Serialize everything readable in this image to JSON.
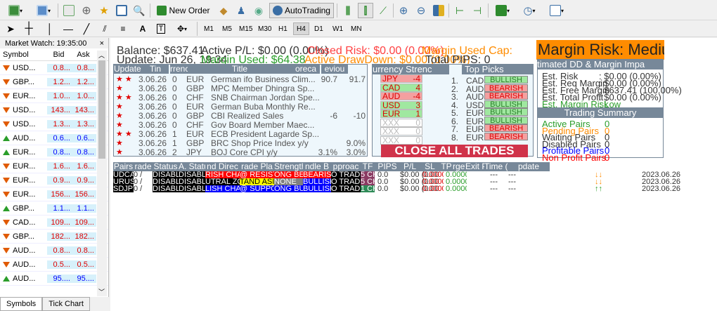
{
  "toolbar": {
    "new_order": "New Order",
    "autotrading": "AutoTrading"
  },
  "timeframes": [
    "M1",
    "M5",
    "M15",
    "M30",
    "H1",
    "H4",
    "D1",
    "W1",
    "MN"
  ],
  "active_tf": "H4",
  "market_watch": {
    "title": "Market Watch: 19:35:00",
    "cols": [
      "Symbol",
      "Bid",
      "Ask"
    ],
    "rows": [
      {
        "sym": "USD...",
        "bid": "0.8...",
        "ask": "0.8...",
        "dir": "dn"
      },
      {
        "sym": "GBP...",
        "bid": "1.2...",
        "ask": "1.2...",
        "dir": "dn"
      },
      {
        "sym": "EUR...",
        "bid": "1.0...",
        "ask": "1.0...",
        "dir": "dn"
      },
      {
        "sym": "USD...",
        "bid": "143...",
        "ask": "143...",
        "dir": "dn"
      },
      {
        "sym": "USD...",
        "bid": "1.3...",
        "ask": "1.3...",
        "dir": "dn"
      },
      {
        "sym": "AUD...",
        "bid": "0.6...",
        "ask": "0.6...",
        "dir": "up"
      },
      {
        "sym": "EUR...",
        "bid": "0.8...",
        "ask": "0.8...",
        "dir": "up"
      },
      {
        "sym": "EUR...",
        "bid": "1.6...",
        "ask": "1.6...",
        "dir": "dn"
      },
      {
        "sym": "EUR...",
        "bid": "0.9...",
        "ask": "0.9...",
        "dir": "dn"
      },
      {
        "sym": "EUR...",
        "bid": "156...",
        "ask": "156...",
        "dir": "dn"
      },
      {
        "sym": "GBP...",
        "bid": "1.1...",
        "ask": "1.1...",
        "dir": "up"
      },
      {
        "sym": "CAD...",
        "bid": "109...",
        "ask": "109...",
        "dir": "dn"
      },
      {
        "sym": "GBP...",
        "bid": "182...",
        "ask": "182...",
        "dir": "dn"
      },
      {
        "sym": "AUD...",
        "bid": "0.8...",
        "ask": "0.8...",
        "dir": "dn"
      },
      {
        "sym": "AUD...",
        "bid": "0.5...",
        "ask": "0.5...",
        "dir": "dn"
      },
      {
        "sym": "AUD...",
        "bid": "95....",
        "ask": "95....",
        "dir": "up"
      }
    ],
    "tabs": [
      "Symbols",
      "Tick Chart"
    ]
  },
  "dash": {
    "balance": "Balance:  $637.41",
    "active_pl": "Active P/L:  $0.00 (0.00%)",
    "closed_risk": "Closed Risk:  $0.00 (0.00%)",
    "margin_used_cap": "Margin Used Cap:",
    "update": "Update:  Jun  26, 19:34",
    "margin_used": "Margin Used:  $64.38",
    "active_drawdown": "Active DrawDown:  $0.00 (0.00%)",
    "total_pips": "Total PIPS: 0",
    "margin_risk": "Margin Risk: Medium",
    "news_headers": [
      "Update &",
      "Tin",
      "rrenc",
      "Title",
      "oreca",
      "eviou"
    ],
    "news": [
      {
        "stars": "★ ★",
        "date": "3.06.26",
        "t": "0",
        "cur": "EUR",
        "title": "German ifo Business Clim...",
        "fc": "90.7",
        "pv": "91.7"
      },
      {
        "stars": "★",
        "date": "3.06.26",
        "t": "0",
        "cur": "GBP",
        "title": "MPC Member Dhingra Sp...",
        "fc": "",
        "pv": ""
      },
      {
        "stars": "★ ★",
        "date": "3.06.26",
        "t": "0",
        "cur": "CHF",
        "title": "SNB Chairman Jordan Spe...",
        "fc": "",
        "pv": ""
      },
      {
        "stars": "★",
        "date": "3.06.26",
        "t": "0",
        "cur": "EUR",
        "title": "German Buba Monthly Re...",
        "fc": "",
        "pv": ""
      },
      {
        "stars": "★",
        "date": "3.06.26",
        "t": "0",
        "cur": "GBP",
        "title": "CBI Realized Sales",
        "fc": "-6",
        "pv": "-10"
      },
      {
        "stars": "★",
        "date": "3.06.26",
        "t": "0",
        "cur": "CHF",
        "title": "Gov Board Member Maec...",
        "fc": "",
        "pv": ""
      },
      {
        "stars": "★ ★",
        "date": "3.06.26",
        "t": "1",
        "cur": "EUR",
        "title": "ECB President Lagarde Sp...",
        "fc": "",
        "pv": ""
      },
      {
        "stars": "★",
        "date": "3.06.26",
        "t": "1",
        "cur": "GBP",
        "title": "BRC Shop Price Index y/y",
        "fc": "",
        "pv": "9.0%"
      },
      {
        "stars": "★",
        "date": "3.06.26",
        "t": "2",
        "cur": "JPY",
        "title": "BOJ Core CPI y/y",
        "fc": "3.1%",
        "pv": "3.0%"
      }
    ],
    "strength_header": "urrency Strenc",
    "strength": [
      {
        "cur": "JPY",
        "val": "-4",
        "col": "#f4a0a0"
      },
      {
        "cur": "CAD",
        "val": "4",
        "col": "#a0e8a0"
      },
      {
        "cur": "AUD",
        "val": "-4",
        "col": "#f4a0a0"
      },
      {
        "cur": "USD",
        "val": "3",
        "col": "#a0e8a0"
      },
      {
        "cur": "EUR",
        "val": "1",
        "col": "#a0e8a0"
      },
      {
        "cur": "XXX",
        "val": "0",
        "col": "#ffffff"
      },
      {
        "cur": "XXX",
        "val": "0",
        "col": "#ffffff"
      },
      {
        "cur": "XXX",
        "val": "0",
        "col": "#ffffff"
      }
    ],
    "picks_header": "Top Picks",
    "picks": [
      {
        "n": "1.",
        "sym": "CAD",
        "sig": "BULLISH"
      },
      {
        "n": "2.",
        "sym": "AUD",
        "sig": "BEARISH"
      },
      {
        "n": "3.",
        "sym": "AUD",
        "sig": "BEARISH"
      },
      {
        "n": "4.",
        "sym": "USD",
        "sig": "BULLISH"
      },
      {
        "n": "5.",
        "sym": "EUR",
        "sig": "BULLISH"
      },
      {
        "n": "6.",
        "sym": "EUR",
        "sig": "BULLISH"
      },
      {
        "n": "7.",
        "sym": "EUR",
        "sig": "BEARISH"
      },
      {
        "n": "8.",
        "sym": "EUR",
        "sig": "BEARISH"
      }
    ],
    "close_all": "CLOSE ALL TRADES",
    "est_header": "timated DD & Margin Impa",
    "est": [
      {
        "l": "Est. Risk",
        "v": ":  $0.00 (0.00%)",
        "c": "#333"
      },
      {
        "l": "Est. Req Margin",
        "v": ":  $0.00 (0.00%)",
        "c": "#333"
      },
      {
        "l": "Est. Free Margin",
        "v": ":  $637.41 (100.00%)",
        "c": "#333"
      },
      {
        "l": "Est. Total Profit",
        "v": ":  $0.00 (0.00%)",
        "c": "#333"
      },
      {
        "l": "Est. Margin Risk",
        "v": ":  Low",
        "c": "#2a9d2a"
      }
    ],
    "trading_header": "Trading Summary",
    "summary": [
      {
        "l": "Active Pairs",
        "v": "0",
        "c": "#2a9d2a"
      },
      {
        "l": "Pending Pairs",
        "v": "0",
        "c": "#ff8c00"
      },
      {
        "l": "Waiting Pairs",
        "v": "0",
        "c": "#333"
      },
      {
        "l": "Disabled Pairs",
        "v": "0",
        "c": "#333"
      },
      {
        "l": "Profitable Pairs",
        "v": "0",
        "c": "#0000ff"
      },
      {
        "l": "Non Profit Pairs",
        "v": "0",
        "c": "#ff0000"
      }
    ],
    "pair_headers": [
      "Pairs",
      "rade",
      "Status",
      "A. Statu",
      "nd Direc",
      "rade Pla",
      "Strength",
      "ndle B",
      "pproac",
      "TF",
      "PIPS",
      "P/L",
      "SL",
      "TP",
      "rget P",
      "Exit Pip",
      "Time (Day)",
      "pdate"
    ],
    "pairs": [
      {
        "p": "UDCA",
        "t": "0 /",
        "st": "DISABLE",
        "as": "DISABLE",
        "dir": "RISH CHAN",
        "dc": "#ff0000",
        "plan": "@ RESISTA",
        "pc": "#ff0000",
        "str": "ONG BEAR",
        "sc": "#ff0000",
        "cb": "BEARISH",
        "cbc": "#ff0000",
        "ap": "O TRAD",
        "tf": "5 CHAR",
        "tfc": "#8b3a62",
        "pips": "0.0",
        "pl": "$0.00 (0.00%)",
        "sl": "0.00000",
        "tp": "0.00000",
        "tgt": "---",
        "ex": "---",
        "time": "2023.06.26",
        "ar": "#ff8c00"
      },
      {
        "p": "URUSI",
        "t": "0 /",
        "st": "DISABLE",
        "as": "DISABLE",
        "dir": "UTRAL ZO",
        "dc": "#000000",
        "plan": "TAND ASID",
        "pc": "#ffff00",
        "str": "NONE",
        "sc": "#808080",
        "cb": "BULLISH",
        "cbc": "#0000ff",
        "ap": "O TRAD",
        "tf": "5 CHAR",
        "tfc": "#8b3a62",
        "pips": "0.0",
        "pl": "$0.00 (0.00%)",
        "sl": "0.00000",
        "tp": "0.00000",
        "tgt": "---",
        "ex": "---",
        "time": "2023.06.26",
        "ar": "#ff8c00"
      },
      {
        "p": "SDJPY",
        "t": "0 /",
        "st": "DISABLE",
        "as": "DISABLE",
        "dir": "LISH CHAN",
        "dc": "#0000ff",
        "plan": "@ SUPPO",
        "pc": "#0000ff",
        "str": "ONG BULL",
        "sc": "#0000ff",
        "cb": "BULLISH",
        "cbc": "#0000ff",
        "ap": "O TRAD",
        "tf": "1 CHAR",
        "tfc": "#2e8b57",
        "pips": "0.0",
        "pl": "$0.00 (0.00%)",
        "sl": "0.00000",
        "tp": "0.00000",
        "tgt": "---",
        "ex": "---",
        "time": "2023.06.26",
        "ar": "#2a9d2a"
      }
    ]
  }
}
